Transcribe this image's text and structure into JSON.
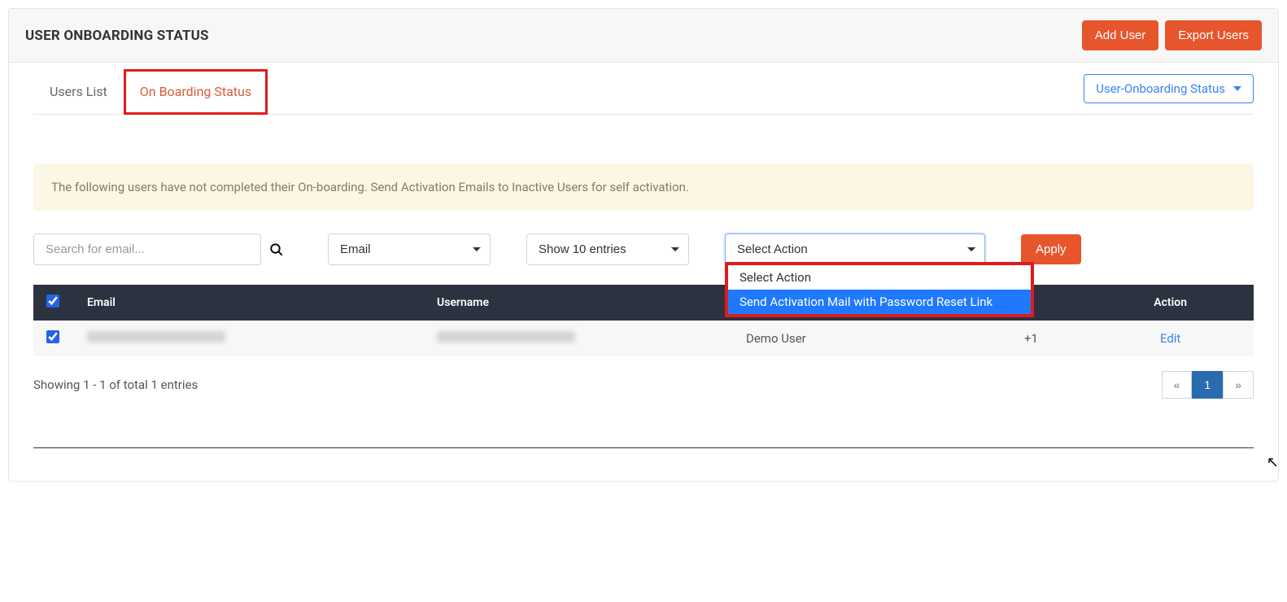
{
  "header": {
    "title": "USER ONBOARDING STATUS",
    "add_user": "Add User",
    "export_users": "Export Users"
  },
  "tabs": {
    "users_list": "Users List",
    "onboarding_status": "On Boarding Status"
  },
  "status_dropdown": "User-Onboarding Status",
  "notice": "The following users have not completed their On-boarding. Send Activation Emails to Inactive Users for self activation.",
  "search": {
    "placeholder": "Search for email..."
  },
  "filter_select": "Email",
  "entries_select": "Show 10 entries",
  "action_select": {
    "selected": "Select Action",
    "option_default": "Select Action",
    "option_send": "Send Activation Mail with Password Reset Link"
  },
  "apply_label": "Apply",
  "table": {
    "col_email": "Email",
    "col_username": "Username",
    "col_action": "Action",
    "row": {
      "role": "Demo User",
      "phone": "+1",
      "edit": "Edit"
    }
  },
  "results_text": "Showing 1 - 1 of total 1 entries",
  "pager": {
    "prev": "«",
    "page1": "1",
    "next": "»"
  }
}
